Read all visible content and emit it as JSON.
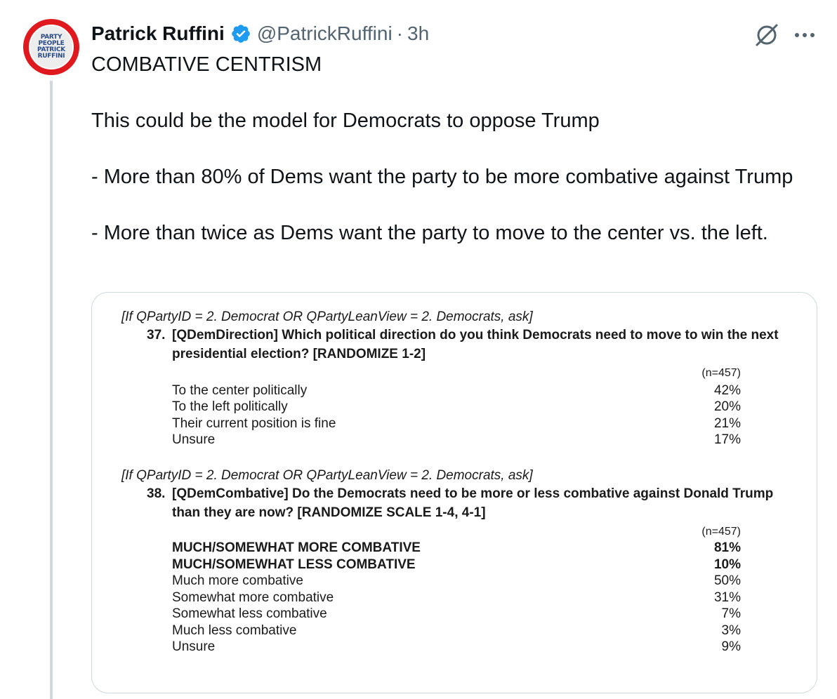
{
  "author": {
    "name": "Patrick Ruffini",
    "handle": "@PatrickRuffini",
    "separator": "·",
    "time": "3h",
    "verified_color": "#1d9bf0",
    "avatar_lines": [
      "PARTY",
      "PEOPLE",
      "PATRICK",
      "RUFFINI"
    ]
  },
  "icons": {
    "grok": "grok-icon",
    "more": "more-icon",
    "verified": "verified-badge-icon"
  },
  "tweet": {
    "line1": "COMBATIVE CENTRISM",
    "line2": "This could be the model for Democrats to oppose Trump",
    "line3": "- More than 80% of Dems want the party to be more combative against Trump",
    "line4": "- More than twice as Dems want the party to move to the center vs. the left."
  },
  "document": {
    "q37": {
      "condition": "[If QPartyID = 2. Democrat OR QPartyLeanView = 2. Democrats, ask]",
      "number": "37.",
      "text": "[QDemDirection] Which political direction do you think Democrats need to move to win the next presidential election? [RANDOMIZE 1-2]",
      "n": "(n=457)",
      "rows": [
        {
          "label": "To the center politically",
          "value": "42%"
        },
        {
          "label": "To the left politically",
          "value": "20%"
        },
        {
          "label": "Their current position is fine",
          "value": "21%"
        },
        {
          "label": "Unsure",
          "value": "17%"
        }
      ]
    },
    "q38": {
      "condition": "[If QPartyID = 2. Democrat OR QPartyLeanView = 2. Democrats, ask]",
      "number": "38.",
      "text": "[QDemCombative] Do the Democrats need to be more or less combative against Donald Trump than they are now? [RANDOMIZE SCALE 1-4, 4-1]",
      "n": "(n=457)",
      "rows": [
        {
          "label": "MUCH/SOMEWHAT MORE COMBATIVE",
          "value": "81%"
        },
        {
          "label": "MUCH/SOMEWHAT LESS COMBATIVE",
          "value": "10%"
        },
        {
          "label": "Much more combative",
          "value": "50%"
        },
        {
          "label": "Somewhat more combative",
          "value": "31%"
        },
        {
          "label": "Somewhat less combative",
          "value": "7%"
        },
        {
          "label": "Much less combative",
          "value": "3%"
        },
        {
          "label": "Unsure",
          "value": "9%"
        }
      ]
    }
  }
}
